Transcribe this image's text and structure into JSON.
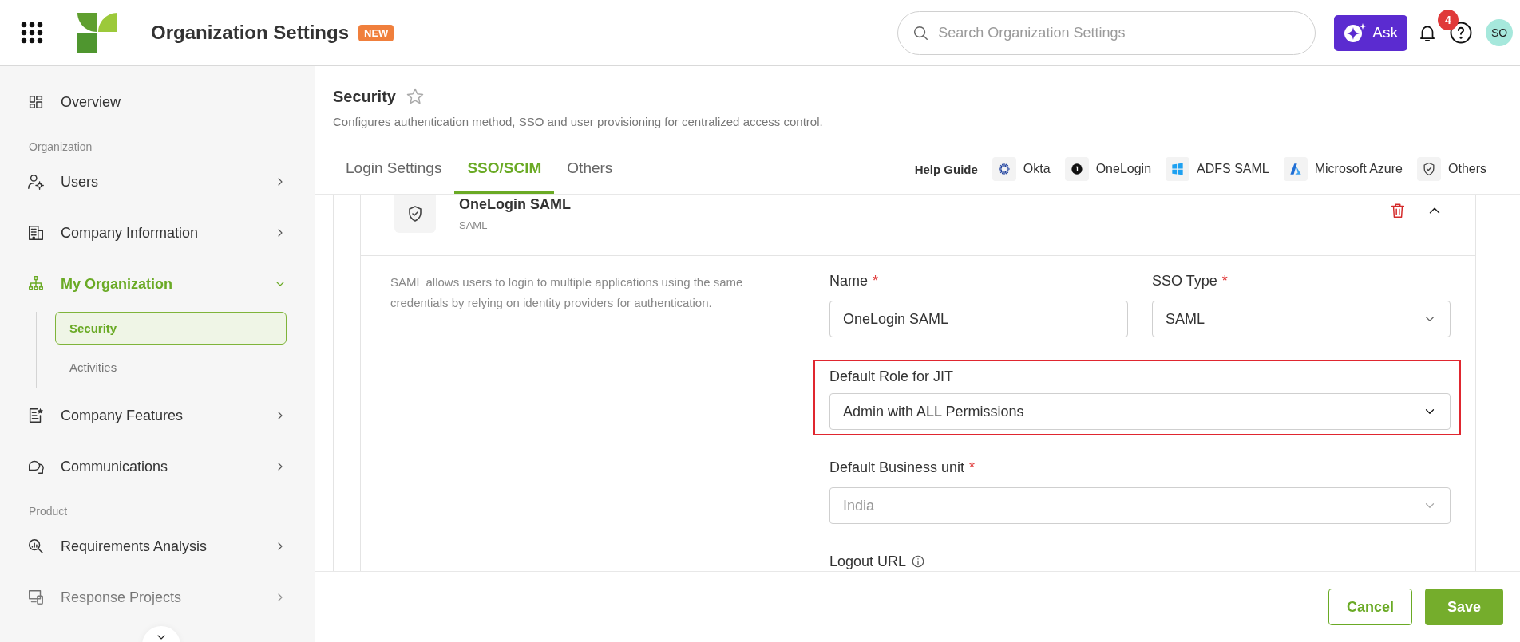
{
  "topbar": {
    "title": "Organization Settings",
    "badge": "NEW",
    "search": {
      "placeholder": "Search Organization Settings"
    },
    "ask_button": "Ask",
    "notification_count": "4",
    "avatar": "SO"
  },
  "sidebar": {
    "items": [
      {
        "kind": "link",
        "label": "Overview"
      },
      {
        "kind": "section",
        "label": "Organization"
      },
      {
        "kind": "group",
        "label": "Users",
        "expanded": false
      },
      {
        "kind": "group",
        "label": "Company Information",
        "expanded": false
      },
      {
        "kind": "group",
        "label": "My Organization",
        "expanded": true,
        "children": [
          {
            "label": "Security",
            "selected": true
          },
          {
            "label": "Activities",
            "selected": false
          }
        ]
      },
      {
        "kind": "group",
        "label": "Company Features",
        "expanded": false
      },
      {
        "kind": "group",
        "label": "Communications",
        "expanded": false
      },
      {
        "kind": "section",
        "label": "Product"
      },
      {
        "kind": "group",
        "label": "Requirements Analysis",
        "expanded": false
      },
      {
        "kind": "group",
        "label": "Response Projects",
        "expanded": false
      }
    ]
  },
  "page": {
    "title": "Security",
    "favorite": false,
    "description": "Configures authentication method, SSO and user provisioning for centralized access control."
  },
  "tabs": [
    {
      "label": "Login Settings",
      "selected": false
    },
    {
      "label": "SSO/SCIM",
      "selected": true
    },
    {
      "label": "Others",
      "selected": false
    }
  ],
  "help_guide": {
    "label": "Help Guide",
    "links": [
      {
        "label": "Okta"
      },
      {
        "label": "OneLogin"
      },
      {
        "label": "ADFS SAML"
      },
      {
        "label": "Microsoft Azure"
      },
      {
        "label": "Others"
      }
    ]
  },
  "sso_card": {
    "title": "OneLogin SAML",
    "subtitle": "SAML",
    "expanded": true,
    "description": "SAML allows users to login to multiple applications using the same credentials by relying on identity providers for authentication.",
    "rows": [
      [
        {
          "kind": "text",
          "label": "Name",
          "required_mark": "*",
          "value": "OneLogin SAML"
        },
        {
          "kind": "select",
          "label": "SSO Type",
          "required_mark": "*",
          "value": "SAML"
        }
      ],
      [
        {
          "kind": "select",
          "label": "Default Role for JIT",
          "value": "Admin with ALL Permissions",
          "highlighted": true
        }
      ],
      [
        {
          "kind": "select",
          "label": "Default Business unit",
          "required_mark": "*",
          "value": "India",
          "disabled": true
        }
      ],
      [
        {
          "kind": "url",
          "label": "Logout URL",
          "info": true
        }
      ]
    ]
  },
  "footer": {
    "buttons": [
      {
        "kind": "secondary",
        "label": "Cancel"
      },
      {
        "kind": "primary",
        "label": "Save"
      }
    ]
  }
}
